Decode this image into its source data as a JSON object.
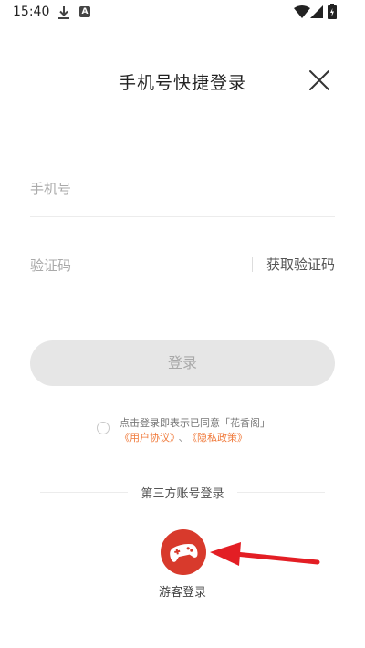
{
  "status_bar": {
    "time": "15:40",
    "icons": [
      "download-icon",
      "a-notification-icon",
      "wifi-icon",
      "signal-icon",
      "battery-icon"
    ]
  },
  "header": {
    "title": "手机号快捷登录",
    "close_icon": "close-icon"
  },
  "form": {
    "phone_placeholder": "手机号",
    "code_placeholder": "验证码",
    "get_code_label": "获取验证码",
    "login_label": "登录"
  },
  "agreement": {
    "text": "点击登录即表示已同意「花香阁」",
    "user_agreement": "《用户协议》",
    "separator": "、",
    "privacy_policy": "《隐私政策》",
    "checked": false
  },
  "third_party": {
    "label": "第三方账号登录",
    "guest_label": "游客登录",
    "guest_icon": "gamepad-icon"
  },
  "colors": {
    "accent": "#d83a2c",
    "link": "#f07a3b",
    "button_disabled_bg": "#e6e6e6",
    "button_disabled_text": "#a8a8a8"
  }
}
